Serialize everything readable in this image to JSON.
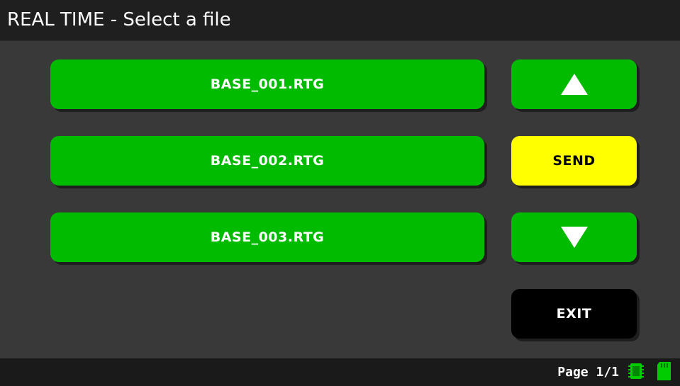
{
  "header": {
    "title": "REAL TIME - Select a file"
  },
  "files": [
    {
      "label": "BASE_001.RTG"
    },
    {
      "label": "BASE_002.RTG"
    },
    {
      "label": "BASE_003.RTG"
    }
  ],
  "controls": {
    "up_icon": "triangle-up-icon",
    "send_label": "SEND",
    "down_icon": "triangle-down-icon",
    "exit_label": "EXIT"
  },
  "status": {
    "page_label": "Page 1/1",
    "icons": [
      "memory-chip-icon",
      "sd-card-icon"
    ]
  },
  "colors": {
    "background": "#393939",
    "title_bar": "#1f1f1f",
    "button_green": "#00bb00",
    "button_yellow": "#ffff00",
    "button_black": "#000000",
    "status_bar": "#1a1a1a"
  }
}
